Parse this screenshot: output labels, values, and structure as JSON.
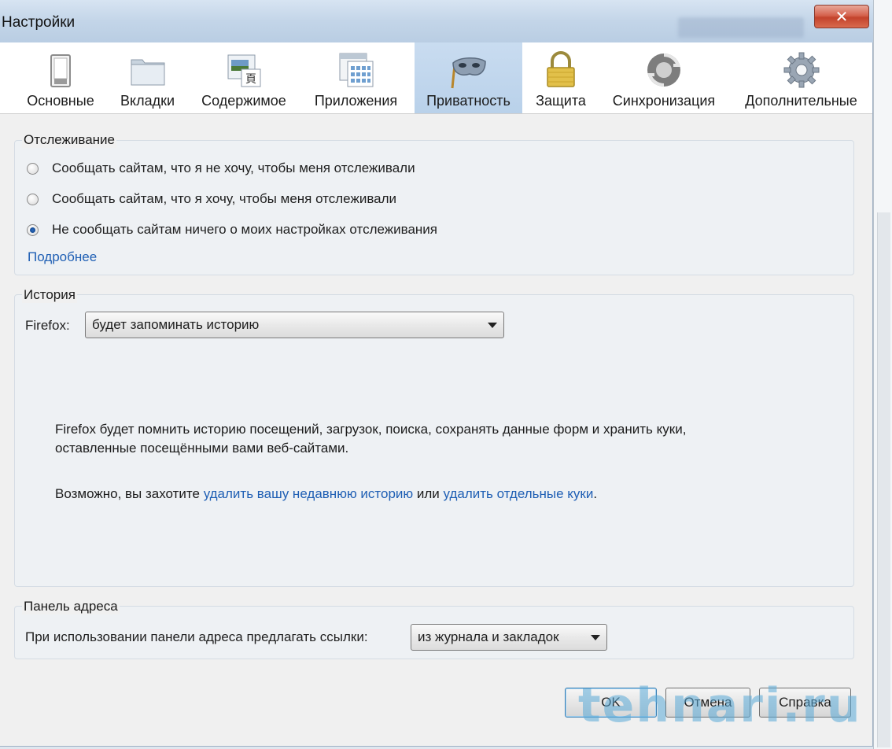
{
  "window": {
    "title": "Настройки",
    "close_glyph": "✕"
  },
  "panes": [
    {
      "label": "Основные",
      "icon": "switch-icon"
    },
    {
      "label": "Вкладки",
      "icon": "folder-tabs-icon"
    },
    {
      "label": "Содержимое",
      "icon": "content-icon"
    },
    {
      "label": "Приложения",
      "icon": "applications-icon"
    },
    {
      "label": "Приватность",
      "icon": "mask-icon",
      "selected": true
    },
    {
      "label": "Защита",
      "icon": "padlock-icon"
    },
    {
      "label": "Синхронизация",
      "icon": "sync-icon"
    },
    {
      "label": "Дополнительные",
      "icon": "gear-icon"
    }
  ],
  "tracking": {
    "legend": "Отслеживание",
    "options": [
      {
        "label": "Сообщать сайтам, что я не хочу, чтобы меня отслеживали",
        "checked": false
      },
      {
        "label": "Сообщать сайтам, что я хочу, чтобы меня отслеживали",
        "checked": false
      },
      {
        "label": "Не сообщать сайтам ничего о моих настройках отслеживания",
        "checked": true
      }
    ],
    "learn_more": "Подробнее"
  },
  "history": {
    "legend": "История",
    "firefox_label": "Firefox:",
    "mode_value": "будет запоминать историю",
    "description_line1": "Firefox будет помнить историю посещений, загрузок, поиска, сохранять данные форм и хранить куки,",
    "description_line2": "оставленные посещёнными вами веб-сайтами.",
    "hint_prefix": "Возможно, вы захотите ",
    "hint_link1": "удалить вашу недавнюю историю",
    "hint_middle": " или ",
    "hint_link2": "удалить отдельные куки",
    "hint_suffix": "."
  },
  "address_bar": {
    "legend": "Панель адреса",
    "label": "При использовании панели адреса предлагать ссылки:",
    "value": "из журнала и закладок"
  },
  "buttons": {
    "ok": "OK",
    "cancel": "Отмена",
    "help": "Справка"
  },
  "watermark": "tehnari.ru",
  "colors": {
    "link": "#1f5fb4",
    "selected_pane": "#b9d1ea",
    "close": "#c3432c"
  }
}
